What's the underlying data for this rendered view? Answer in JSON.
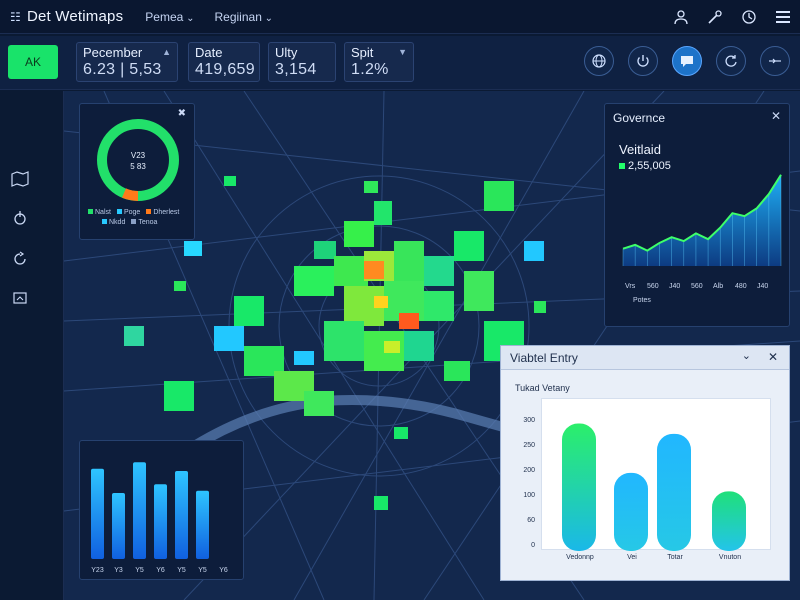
{
  "app": {
    "title": "Det Wetimaps",
    "nav": [
      "Pemea",
      "Regiinan"
    ]
  },
  "kpis": [
    {
      "label": "Pecember",
      "value": "6.23 | 5,53"
    },
    {
      "label": "Date",
      "value": "419,659"
    },
    {
      "label": "Ulty",
      "value": "3,154"
    },
    {
      "label": "Spit",
      "value": "1.2%"
    }
  ],
  "ok_label": "AK",
  "top_icons": [
    "user-icon",
    "tools-icon",
    "clock-icon",
    "menu-icon"
  ],
  "round_buttons": [
    "globe-icon",
    "power-icon",
    "chat-icon",
    "refresh-icon",
    "collapse-icon"
  ],
  "sidebar": [
    "map-icon",
    "hand-icon",
    "loop-icon",
    "screen-icon"
  ],
  "donut": {
    "center_lines": [
      "V23",
      "5 83"
    ],
    "legend": [
      "Nalst",
      "Poge",
      "Dherlest",
      "Nkdd",
      "Tenoa"
    ],
    "colors": {
      "ring": "#22e06a",
      "accent": "#ff7a1a"
    }
  },
  "governance": {
    "title": "Governce",
    "subtitle": "Veitlaid",
    "value": "2,55,005",
    "x_ticks": [
      "Vrs",
      "560",
      "J40",
      "560",
      "Alb",
      "480",
      "J40"
    ],
    "x_label": "Potes"
  },
  "chart_data": [
    {
      "type": "area",
      "title": "",
      "x": [
        "Vrs",
        "560",
        "J40",
        "560",
        "Alb",
        "480",
        "J40"
      ],
      "series": [
        {
          "values": [
            18,
            22,
            16,
            24,
            30,
            26,
            34,
            28,
            40,
            55,
            52,
            60,
            75,
            95
          ]
        }
      ],
      "ylim": [
        0,
        100
      ]
    },
    {
      "type": "bar",
      "categories": [
        "Y23",
        "Y3",
        "Y5",
        "Y6",
        "Y5",
        "Y5",
        "Y6"
      ],
      "values": [
        82,
        60,
        88,
        68,
        80,
        62,
        0
      ],
      "ylim": [
        0,
        100
      ]
    },
    {
      "type": "bar",
      "title": "Tukad Vetany",
      "categories": [
        "Vedonnp",
        "Vei",
        "Totar",
        "Vnuton"
      ],
      "values": [
        310,
        190,
        285,
        145
      ],
      "yticks": [
        "0",
        "60",
        "100",
        "200",
        "250",
        "300",
        "350"
      ],
      "ylim": [
        0,
        360
      ]
    }
  ],
  "window": {
    "title": "Viabtel Entry",
    "chart_title": "Tukad Vetany"
  }
}
